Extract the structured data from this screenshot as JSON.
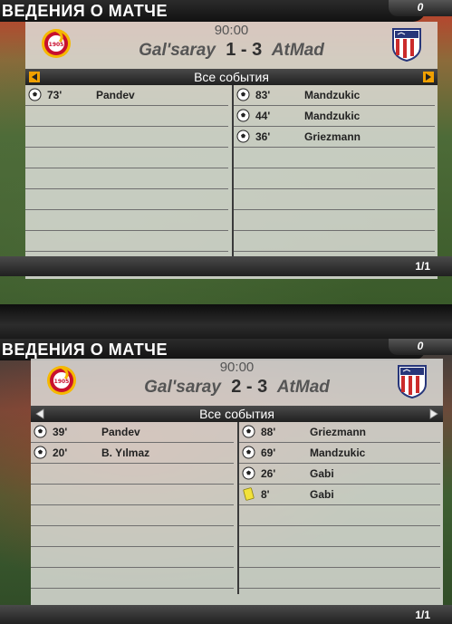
{
  "panels": [
    {
      "title": "ВЕДЕНИЯ О МАТЧЕ",
      "corner": "0",
      "time": "90:00",
      "home_team": "Gal'saray",
      "away_team": "AtMad",
      "home_score": "1",
      "away_score": "3",
      "events_header": "Все события",
      "home_events": [
        {
          "icon": "ball-icon",
          "minute": "73'",
          "player": "Pandev"
        }
      ],
      "away_events": [
        {
          "icon": "ball-icon",
          "minute": "83'",
          "player": "Mandzukic"
        },
        {
          "icon": "ball-icon",
          "minute": "44'",
          "player": "Mandzukic"
        },
        {
          "icon": "ball-icon",
          "minute": "36'",
          "player": "Griezmann"
        }
      ],
      "page": "1/1"
    },
    {
      "title": "ВЕДЕНИЯ О МАТЧЕ",
      "corner": "0",
      "time": "90:00",
      "home_team": "Gal'saray",
      "away_team": "AtMad",
      "home_score": "2",
      "away_score": "3",
      "events_header": "Все события",
      "home_events": [
        {
          "icon": "ball-icon",
          "minute": "39'",
          "player": "Pandev"
        },
        {
          "icon": "ball-icon",
          "minute": "20'",
          "player": "B. Yılmaz"
        }
      ],
      "away_events": [
        {
          "icon": "ball-icon",
          "minute": "88'",
          "player": "Griezmann"
        },
        {
          "icon": "ball-icon",
          "minute": "69'",
          "player": "Mandzukic"
        },
        {
          "icon": "ball-icon",
          "minute": "26'",
          "player": "Gabi"
        },
        {
          "icon": "yellow-card-icon",
          "minute": "8'",
          "player": "Gabi"
        }
      ],
      "page": "1/1"
    }
  ],
  "colors": {
    "galatasaray_red": "#c8102e",
    "galatasaray_yellow": "#f5b800",
    "atletico_red": "#cb2b2b",
    "atletico_blue": "#27367a",
    "yellow_card": "#f2e23a"
  }
}
